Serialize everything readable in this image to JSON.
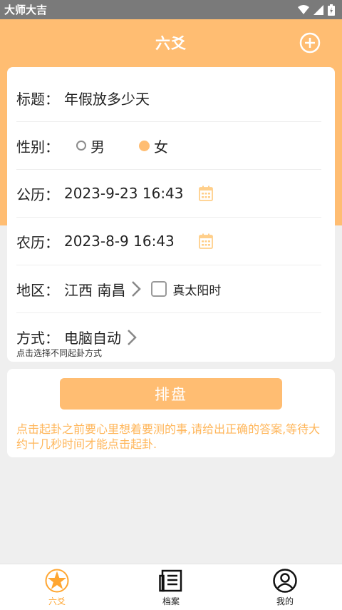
{
  "status_bar": {
    "left_text": "大师大吉"
  },
  "header": {
    "title": "六爻"
  },
  "form": {
    "title_label": "标题：",
    "title_value": "年假放多少天",
    "gender_label": "性别：",
    "gender_options": [
      "男",
      "女"
    ],
    "gender_selected": "女",
    "solar_label": "公历：",
    "solar_value": "2023-9-23 16:43",
    "lunar_label": "农历：",
    "lunar_value": "2023-8-9 16:43",
    "region_label": "地区：",
    "region_value": "江西 南昌",
    "true_solar_label": "真太阳时",
    "method_label": "方式：",
    "method_value": "电脑自动",
    "method_hint": "点击选择不同起卦方式"
  },
  "action": {
    "button_label": "排盘",
    "notice": "点击起卦之前要心里想着要测的事,请给出正确的答案,等待大约十几秒时间才能点击起卦."
  },
  "tabs": [
    {
      "label": "六爻",
      "icon": "star-icon",
      "active": true
    },
    {
      "label": "档案",
      "icon": "archive-icon",
      "active": false
    },
    {
      "label": "我的",
      "icon": "user-icon",
      "active": false
    }
  ],
  "colors": {
    "accent": "#ffbd72",
    "accent_text": "#ffa631",
    "notice": "#ffb65a"
  }
}
